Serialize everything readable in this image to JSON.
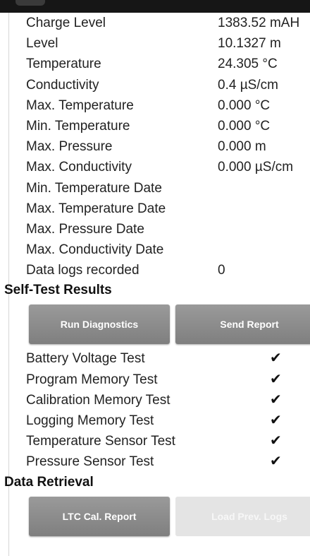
{
  "device_info": [
    {
      "label": "Charge Level",
      "value": "1383.52 mAH"
    },
    {
      "label": "Level",
      "value": "10.1327 m"
    },
    {
      "label": "Temperature",
      "value": "24.305 °C"
    },
    {
      "label": "Conductivity",
      "value": "0.4 µS/cm"
    },
    {
      "label": "Max. Temperature",
      "value": "0.000 °C"
    },
    {
      "label": "Min. Temperature",
      "value": "0.000 °C"
    },
    {
      "label": "Max. Pressure",
      "value": "0.000 m"
    },
    {
      "label": "Max. Conductivity",
      "value": "0.000 µS/cm"
    },
    {
      "label": "Min. Temperature Date",
      "value": ""
    },
    {
      "label": "Max. Temperature Date",
      "value": ""
    },
    {
      "label": "Max. Pressure Date",
      "value": ""
    },
    {
      "label": "Max. Conductivity Date",
      "value": ""
    },
    {
      "label": "Data logs recorded",
      "value": "0"
    }
  ],
  "self_test": {
    "title": "Self-Test Results",
    "run_button": "Run Diagnostics",
    "send_button": "Send Report",
    "check_glyph": "✔",
    "tests": [
      {
        "label": "Battery Voltage Test",
        "passed": true
      },
      {
        "label": "Program Memory Test",
        "passed": true
      },
      {
        "label": "Calibration Memory Test",
        "passed": true
      },
      {
        "label": "Logging Memory Test",
        "passed": true
      },
      {
        "label": "Temperature Sensor Test",
        "passed": true
      },
      {
        "label": "Pressure Sensor Test",
        "passed": true
      }
    ]
  },
  "data_retrieval": {
    "title": "Data Retrieval",
    "cal_report_button": "LTC Cal. Report",
    "load_logs_button": "Load Prev. Logs",
    "load_logs_enabled": false
  },
  "colors": {
    "button_bg": "#8c8c8c",
    "button_disabled_bg": "#e4e4e4",
    "top_bar": "#161616"
  }
}
